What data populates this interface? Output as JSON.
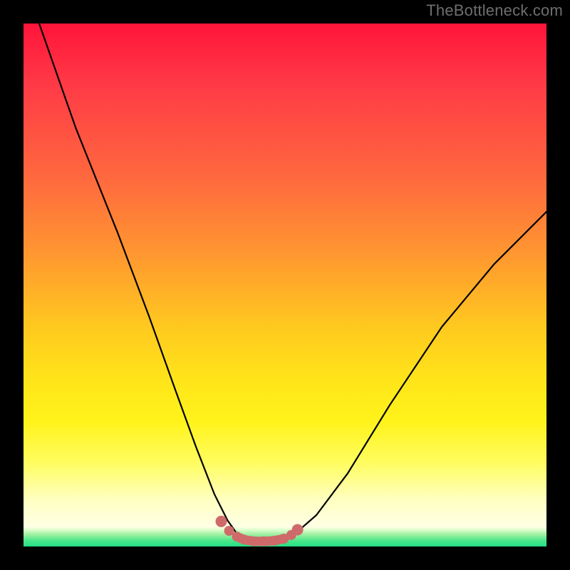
{
  "watermark": "TheBottleneck.com",
  "chart_data": {
    "type": "line",
    "title": "",
    "xlabel": "",
    "ylabel": "",
    "xlim": [
      0,
      100
    ],
    "ylim": [
      0,
      100
    ],
    "series": [
      {
        "name": "bottleneck-curve",
        "x": [
          3,
          10,
          18,
          24,
          29,
          33,
          36.5,
          39,
          41,
          42.5,
          44,
          46,
          49,
          52,
          56,
          62,
          70,
          80,
          90,
          100
        ],
        "y": [
          100,
          80,
          60,
          44,
          30,
          19,
          10,
          5,
          2.2,
          1.2,
          1.0,
          1.0,
          1.2,
          2.5,
          6,
          14,
          27,
          42,
          54,
          64
        ]
      }
    ],
    "markers": {
      "color": "#cf6a6a",
      "points_x": [
        37.8,
        39.3,
        40.8,
        42.2,
        44.0,
        46.0,
        48.0,
        49.8,
        51.2,
        52.4
      ],
      "points_y": [
        4.8,
        3.0,
        1.9,
        1.3,
        1.0,
        1.0,
        1.1,
        1.5,
        2.2,
        3.2
      ]
    },
    "background_gradient": {
      "top": "#ff143a",
      "mid": "#ffe41a",
      "bottom": "#ffffff",
      "floor_band": "#22df86"
    }
  }
}
